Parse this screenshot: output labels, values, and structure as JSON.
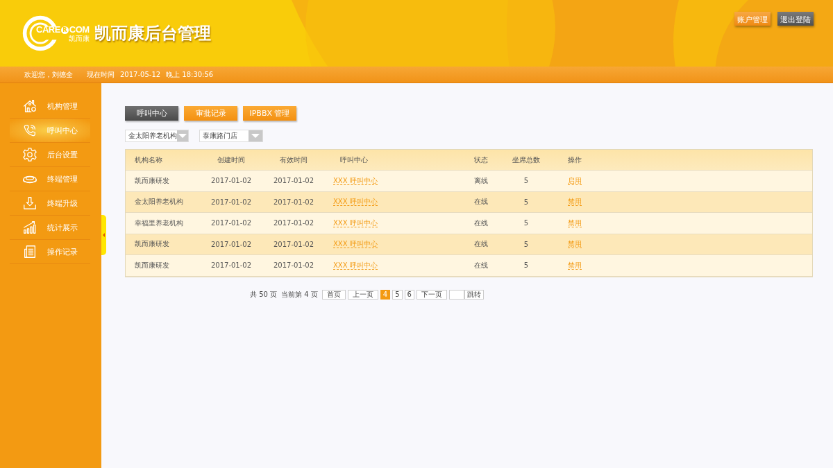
{
  "logo": {
    "left": "CARE",
    "mark": "R",
    "right": "COM",
    "sub": "凯而康"
  },
  "app_title": "凯而康后台管理",
  "header_buttons": [
    {
      "label": "账户管理",
      "kind": "orange"
    },
    {
      "label": "退出登陆",
      "kind": "dark"
    }
  ],
  "welcome_bar": {
    "greeting": "欢迎您，刘德全",
    "time_label": "现在时间",
    "date": "2017-05-12",
    "time": "晚上 18:30:56"
  },
  "sidebar": {
    "items": [
      {
        "label": "机构管理",
        "selected": false
      },
      {
        "label": "呼叫中心",
        "selected": true
      },
      {
        "label": "后台设置",
        "selected": false
      },
      {
        "label": "终端管理",
        "selected": false
      },
      {
        "label": "终端升级",
        "selected": false
      },
      {
        "label": "统计展示",
        "selected": false
      },
      {
        "label": "操作记录",
        "selected": false
      }
    ]
  },
  "tabs": [
    {
      "label": "呼叫中心",
      "selected": true
    },
    {
      "label": "审批记录",
      "selected": false
    },
    {
      "label": "IPBBX 管理",
      "selected": false
    }
  ],
  "filters": [
    {
      "value": "金太阳养老机构"
    },
    {
      "value": "泰康路门店"
    }
  ],
  "table": {
    "columns": [
      "机构名称",
      "创建时间",
      "有效时间",
      "呼叫中心",
      "状态",
      "坐席总数",
      "操作"
    ],
    "rows": [
      {
        "name": "凯而康研发",
        "created": "2017-01-02",
        "valid": "2017-01-02",
        "call_center": "XXX 呼叫中心",
        "status": "离线",
        "seats": "5",
        "action": "启用"
      },
      {
        "name": "金太阳养老机构",
        "created": "2017-01-02",
        "valid": "2017-01-02",
        "call_center": "XXX 呼叫中心",
        "status": "在线",
        "seats": "5",
        "action": "禁用"
      },
      {
        "name": "幸福里养老机构",
        "created": "2017-01-02",
        "valid": "2017-01-02",
        "call_center": "XXX 呼叫中心",
        "status": "在线",
        "seats": "5",
        "action": "禁用"
      },
      {
        "name": "凯而康研发",
        "created": "2017-01-02",
        "valid": "2017-01-02",
        "call_center": "XXX 呼叫中心",
        "status": "在线",
        "seats": "5",
        "action": "禁用"
      },
      {
        "name": "凯而康研发",
        "created": "2017-01-02",
        "valid": "2017-01-02",
        "call_center": "XXX 呼叫中心",
        "status": "在线",
        "seats": "5",
        "action": "禁用"
      }
    ]
  },
  "pagination": {
    "total": "共 50 页",
    "current": "当前第 4 页",
    "first": "首页",
    "prev": "上一页",
    "pages": [
      {
        "label": "4",
        "selected": true
      },
      {
        "label": "5",
        "selected": false
      },
      {
        "label": "6",
        "selected": false
      }
    ],
    "next": "下一页",
    "jump": "跳转"
  }
}
